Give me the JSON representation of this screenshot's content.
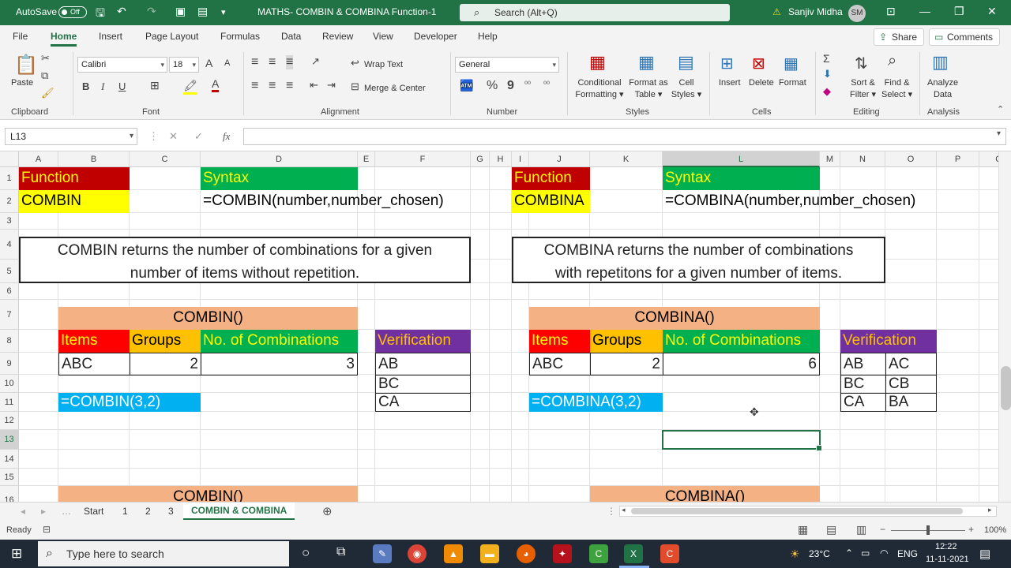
{
  "titlebar": {
    "autosave_label": "AutoSave",
    "autosave_state": "Off",
    "doc_title": "MATHS- COMBIN & COMBINA Function-1",
    "search_placeholder": "Search (Alt+Q)",
    "user_name": "Sanjiv Midha",
    "user_initials": "SM"
  },
  "ribbon_tabs": [
    "File",
    "Home",
    "Insert",
    "Page Layout",
    "Formulas",
    "Data",
    "Review",
    "View",
    "Developer",
    "Help"
  ],
  "active_tab": "Home",
  "share_label": "Share",
  "comments_label": "Comments",
  "ribbon": {
    "clipboard": {
      "group": "Clipboard",
      "paste": "Paste"
    },
    "font": {
      "group": "Font",
      "name": "Calibri",
      "size": "18",
      "bold": "B",
      "italic": "I",
      "underline": "U"
    },
    "alignment": {
      "group": "Alignment",
      "wrap": "Wrap Text",
      "merge": "Merge & Center"
    },
    "number": {
      "group": "Number",
      "format": "General",
      "percent": "%",
      "comma": "9"
    },
    "styles": {
      "group": "Styles",
      "cond1": "Conditional",
      "cond2": "Formatting ▾",
      "fmt1": "Format as",
      "fmt2": "Table ▾",
      "cell1": "Cell",
      "cell2": "Styles ▾"
    },
    "cells": {
      "group": "Cells",
      "insert": "Insert",
      "delete": "Delete",
      "format": "Format"
    },
    "editing": {
      "group": "Editing",
      "sort1": "Sort &",
      "sort2": "Filter ▾",
      "find1": "Find &",
      "find2": "Select ▾"
    },
    "analysis": {
      "group": "Analysis",
      "analyze1": "Analyze",
      "analyze2": "Data"
    }
  },
  "formula_bar": {
    "name_box": "L13",
    "cancel": "✕",
    "enter": "✓",
    "fx": "fx",
    "content": ""
  },
  "columns": [
    "A",
    "B",
    "C",
    "D",
    "E",
    "F",
    "G",
    "H",
    "I",
    "J",
    "K",
    "L",
    "M",
    "N",
    "O",
    "P",
    "Q"
  ],
  "rows": [
    "1",
    "2",
    "3",
    "4",
    "5",
    "6",
    "7",
    "8",
    "9",
    "10",
    "11",
    "12",
    "13",
    "14",
    "15",
    "16"
  ],
  "left": {
    "function_label": "Function",
    "function_name": "COMBIN",
    "syntax_label": "Syntax",
    "syntax": "=COMBIN(number,number_chosen)",
    "description_line1": "COMBIN returns the number of combinations for a given",
    "description_line2": "number of items without repetition.",
    "table_title": "COMBIN()",
    "headers": [
      "Items",
      "Groups",
      "No. of Combinations"
    ],
    "values": [
      "ABC",
      "2",
      "3"
    ],
    "formula": "=COMBIN(3,2)",
    "verification_label": "Verification",
    "verification": [
      "AB",
      "BC",
      "CA"
    ],
    "bottom_title": "COMBIN()"
  },
  "right": {
    "function_label": "Function",
    "function_name": "COMBINA",
    "syntax_label": "Syntax",
    "syntax": "=COMBINA(number,number_chosen)",
    "description_line1": "COMBINA returns the number of combinations",
    "description_line2": "with repetitons for a given number of items.",
    "table_title": "COMBINA()",
    "headers": [
      "Items",
      "Groups",
      "No. of Combinations"
    ],
    "values": [
      "ABC",
      "2",
      "6"
    ],
    "formula": "=COMBINA(3,2)",
    "verification_label": "Verification",
    "verification": [
      [
        "AB",
        "AC"
      ],
      [
        "BC",
        "CB"
      ],
      [
        "CA",
        "BA"
      ]
    ],
    "bottom_title": "COMBINA()"
  },
  "sheets": [
    "Start",
    "1",
    "2",
    "3",
    "COMBIN & COMBINA"
  ],
  "active_sheet": "COMBIN & COMBINA",
  "status": {
    "ready": "Ready",
    "zoom": "100%"
  },
  "taskbar": {
    "search_placeholder": "Type here to search",
    "weather": "23°C",
    "lang": "ENG",
    "time": "12:22",
    "date": "11-11-2021"
  },
  "colors": {
    "excel_green": "#217346",
    "function_red": "#c00000",
    "yellow": "#ffff00",
    "syntax_green": "#00b050",
    "orange_title": "#f4b183",
    "hdr_orange": "#ffc000",
    "verify_purple": "#7030a0",
    "formula_blue": "#00b0f0"
  }
}
